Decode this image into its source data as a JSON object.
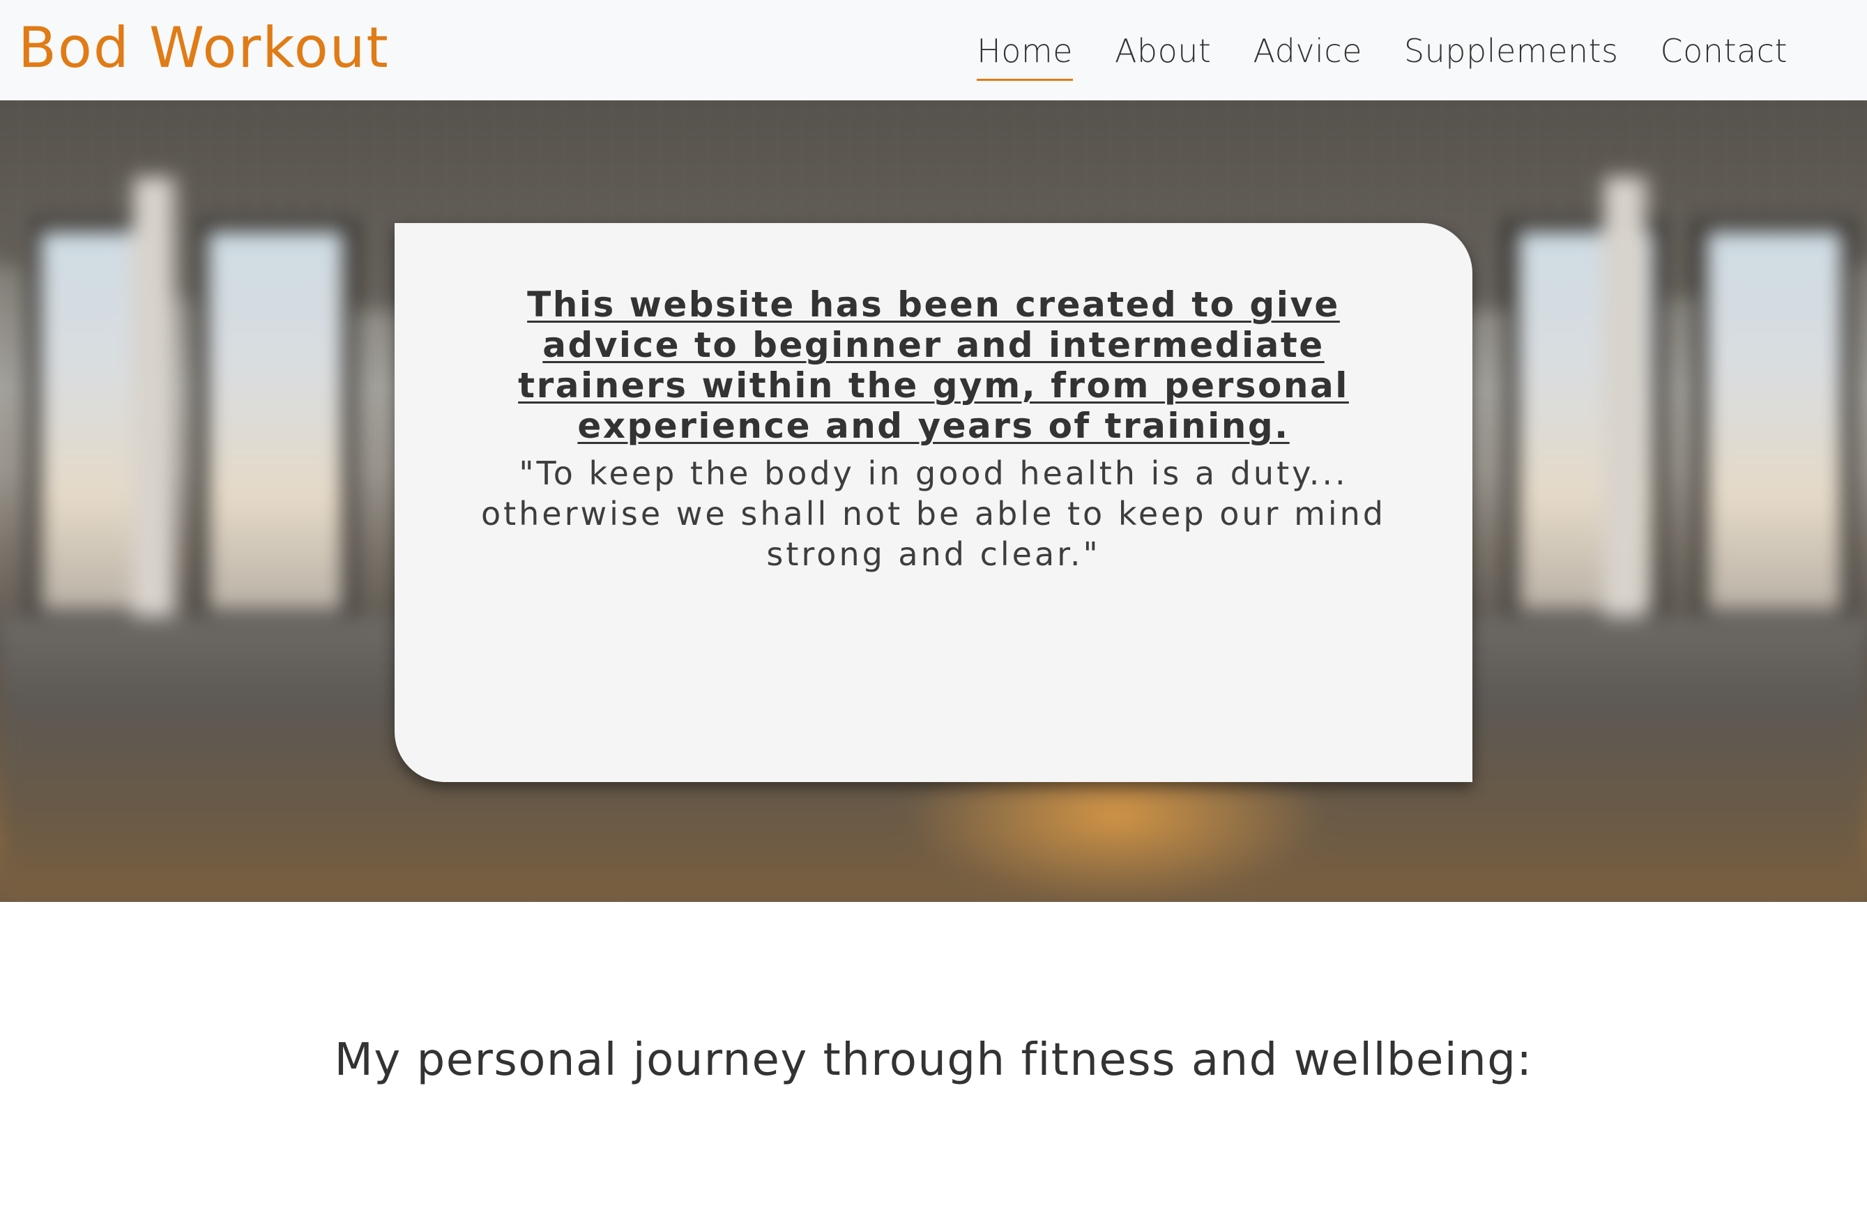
{
  "site": {
    "brand": "Bod Workout"
  },
  "nav": {
    "items": [
      {
        "label": "Home",
        "active": true
      },
      {
        "label": "About",
        "active": false
      },
      {
        "label": "Advice",
        "active": false
      },
      {
        "label": "Supplements",
        "active": false
      },
      {
        "label": "Contact",
        "active": false
      }
    ]
  },
  "hero": {
    "heading": "This website has been created to give advice to beginner and intermediate trainers within the gym, from personal experience and years of training.",
    "quote": "\"To keep the body in good health is a duty... otherwise we shall not be able to keep our mind strong and clear.\""
  },
  "journey": {
    "title": "My personal journey through fitness and wellbeing:"
  },
  "colors": {
    "accent": "#e07b16",
    "text": "#333333",
    "navbar_bg": "#f8f9fa",
    "card_bg": "#f5f5f5"
  }
}
